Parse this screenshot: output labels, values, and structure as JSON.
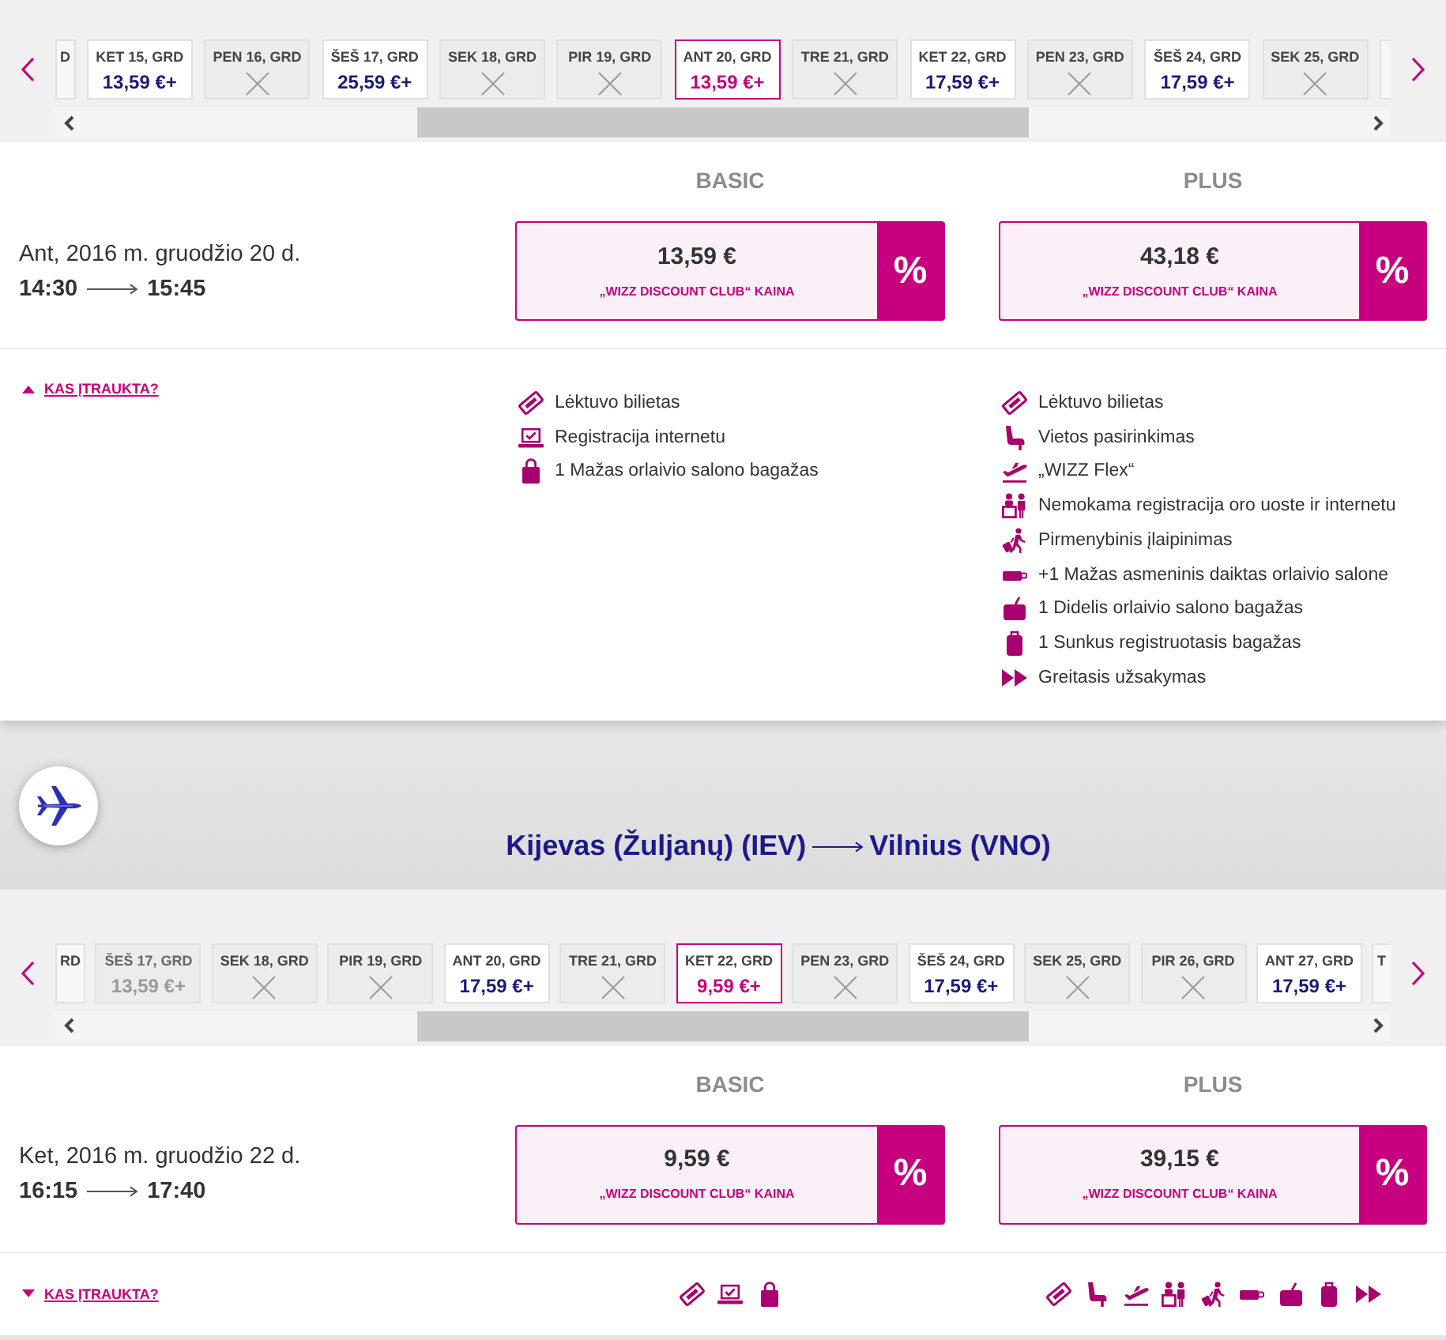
{
  "flights": [
    {
      "date_strip": {
        "cards": [
          {
            "kind": "partial",
            "label": "D",
            "selected": false,
            "disabled": false
          },
          {
            "kind": "price",
            "label": "KET 15, GRD",
            "price": "13,59 €+",
            "selected": false,
            "disabled": false
          },
          {
            "kind": "sold_out",
            "label": "PEN 16, GRD",
            "selected": false,
            "disabled": false
          },
          {
            "kind": "price",
            "label": "ŠEŠ 17, GRD",
            "price": "25,59 €+",
            "selected": false,
            "disabled": false
          },
          {
            "kind": "sold_out",
            "label": "SEK 18, GRD",
            "selected": false,
            "disabled": false
          },
          {
            "kind": "sold_out",
            "label": "PIR 19, GRD",
            "selected": false,
            "disabled": false
          },
          {
            "kind": "price",
            "label": "ANT 20, GRD",
            "price": "13,59 €+",
            "selected": true,
            "disabled": false
          },
          {
            "kind": "sold_out",
            "label": "TRE 21, GRD",
            "selected": false,
            "disabled": false
          },
          {
            "kind": "price",
            "label": "KET 22, GRD",
            "price": "17,59 €+",
            "selected": false,
            "disabled": false
          },
          {
            "kind": "sold_out",
            "label": "PEN 23, GRD",
            "selected": false,
            "disabled": false
          },
          {
            "kind": "price",
            "label": "ŠEŠ 24, GRD",
            "price": "17,59 €+",
            "selected": false,
            "disabled": false
          },
          {
            "kind": "sold_out",
            "label": "SEK 25, GRD",
            "selected": false,
            "disabled": false
          },
          {
            "kind": "partial",
            "selected": false,
            "disabled": false
          }
        ]
      },
      "fares": {
        "date": "Ant, 2016 m. gruodžio 20 d.",
        "departure": "14:30",
        "arrival": "15:45",
        "plans": [
          {
            "name": "BASIC",
            "price": "13,59 €",
            "note": "„WIZZ DISCOUNT CLUB“ KAINA",
            "badge": "%"
          },
          {
            "name": "PLUS",
            "price": "43,18 €",
            "note": "„WIZZ DISCOUNT CLUB“ KAINA",
            "badge": "%"
          }
        ]
      },
      "included": {
        "toggle": "KAS ĮTRAUKTA?",
        "expanded": true,
        "plans": [
          {
            "features": [
              {
                "kind": "ticket",
                "label": "Lėktuvo bilietas"
              },
              {
                "kind": "laptop",
                "label": "Registracija internetu"
              },
              {
                "kind": "bag",
                "label": "1 Mažas orlaivio salono bagažas"
              }
            ]
          },
          {
            "features": [
              {
                "kind": "ticket",
                "label": "Lėktuvo bilietas"
              },
              {
                "kind": "seat",
                "label": "Vietos pasirinkimas"
              },
              {
                "kind": "flex",
                "label": "„WIZZ Flex“"
              },
              {
                "kind": "desk",
                "label": "Nemokama registracija oro uoste ir internetu"
              },
              {
                "kind": "boarding",
                "label": "Pirmenybinis įlaipinimas"
              },
              {
                "kind": "item",
                "label": "+1 Mažas asmeninis daiktas orlaivio salone"
              },
              {
                "kind": "cabin_bag",
                "label": "1 Didelis orlaivio salono bagažas"
              },
              {
                "kind": "suitcase",
                "label": "1 Sunkus registruotasis bagažas"
              },
              {
                "kind": "fast",
                "label": "Greitasis užsakymas"
              }
            ]
          }
        ]
      }
    },
    {
      "route": {
        "origin": "Kijevas (Žuljanų) (IEV)",
        "destination": "Vilnius (VNO)"
      },
      "date_strip": {
        "cards": [
          {
            "kind": "partial",
            "label": "RD",
            "selected": false,
            "disabled": false
          },
          {
            "kind": "price",
            "label": "ŠEŠ 17, GRD",
            "price": "13,59 €+",
            "selected": false,
            "disabled": true
          },
          {
            "kind": "sold_out",
            "label": "SEK 18, GRD",
            "selected": false,
            "disabled": false
          },
          {
            "kind": "sold_out",
            "label": "PIR 19, GRD",
            "selected": false,
            "disabled": false
          },
          {
            "kind": "price",
            "label": "ANT 20, GRD",
            "price": "17,59 €+",
            "selected": false,
            "disabled": false
          },
          {
            "kind": "sold_out",
            "label": "TRE 21, GRD",
            "selected": false,
            "disabled": false
          },
          {
            "kind": "price",
            "label": "KET 22, GRD",
            "price": "9,59 €+",
            "selected": true,
            "disabled": false
          },
          {
            "kind": "sold_out",
            "label": "PEN 23, GRD",
            "selected": false,
            "disabled": false
          },
          {
            "kind": "price",
            "label": "ŠEŠ 24, GRD",
            "price": "17,59 €+",
            "selected": false,
            "disabled": false
          },
          {
            "kind": "sold_out",
            "label": "SEK 25, GRD",
            "selected": false,
            "disabled": false
          },
          {
            "kind": "sold_out",
            "label": "PIR 26, GRD",
            "selected": false,
            "disabled": false
          },
          {
            "kind": "price",
            "label": "ANT 27, GRD",
            "price": "17,59 €+",
            "selected": false,
            "disabled": false
          },
          {
            "kind": "partial",
            "label": "T",
            "selected": false,
            "disabled": false
          }
        ]
      },
      "fares": {
        "date": "Ket, 2016 m. gruodžio 22 d.",
        "departure": "16:15",
        "arrival": "17:40",
        "plans": [
          {
            "name": "BASIC",
            "price": "9,59 €",
            "note": "„WIZZ DISCOUNT CLUB“ KAINA",
            "badge": "%"
          },
          {
            "name": "PLUS",
            "price": "39,15 €",
            "note": "„WIZZ DISCOUNT CLUB“ KAINA",
            "badge": "%"
          }
        ]
      },
      "included": {
        "toggle": "KAS ĮTRAUKTA?",
        "expanded": false,
        "plans": [
          {
            "features": [
              {
                "kind": "ticket"
              },
              {
                "kind": "laptop"
              },
              {
                "kind": "bag"
              }
            ]
          },
          {
            "features": [
              {
                "kind": "ticket"
              },
              {
                "kind": "seat"
              },
              {
                "kind": "flex"
              },
              {
                "kind": "desk"
              },
              {
                "kind": "boarding"
              },
              {
                "kind": "item"
              },
              {
                "kind": "cabin_bag"
              },
              {
                "kind": "suitcase"
              },
              {
                "kind": "fast"
              }
            ]
          }
        ]
      }
    }
  ]
}
